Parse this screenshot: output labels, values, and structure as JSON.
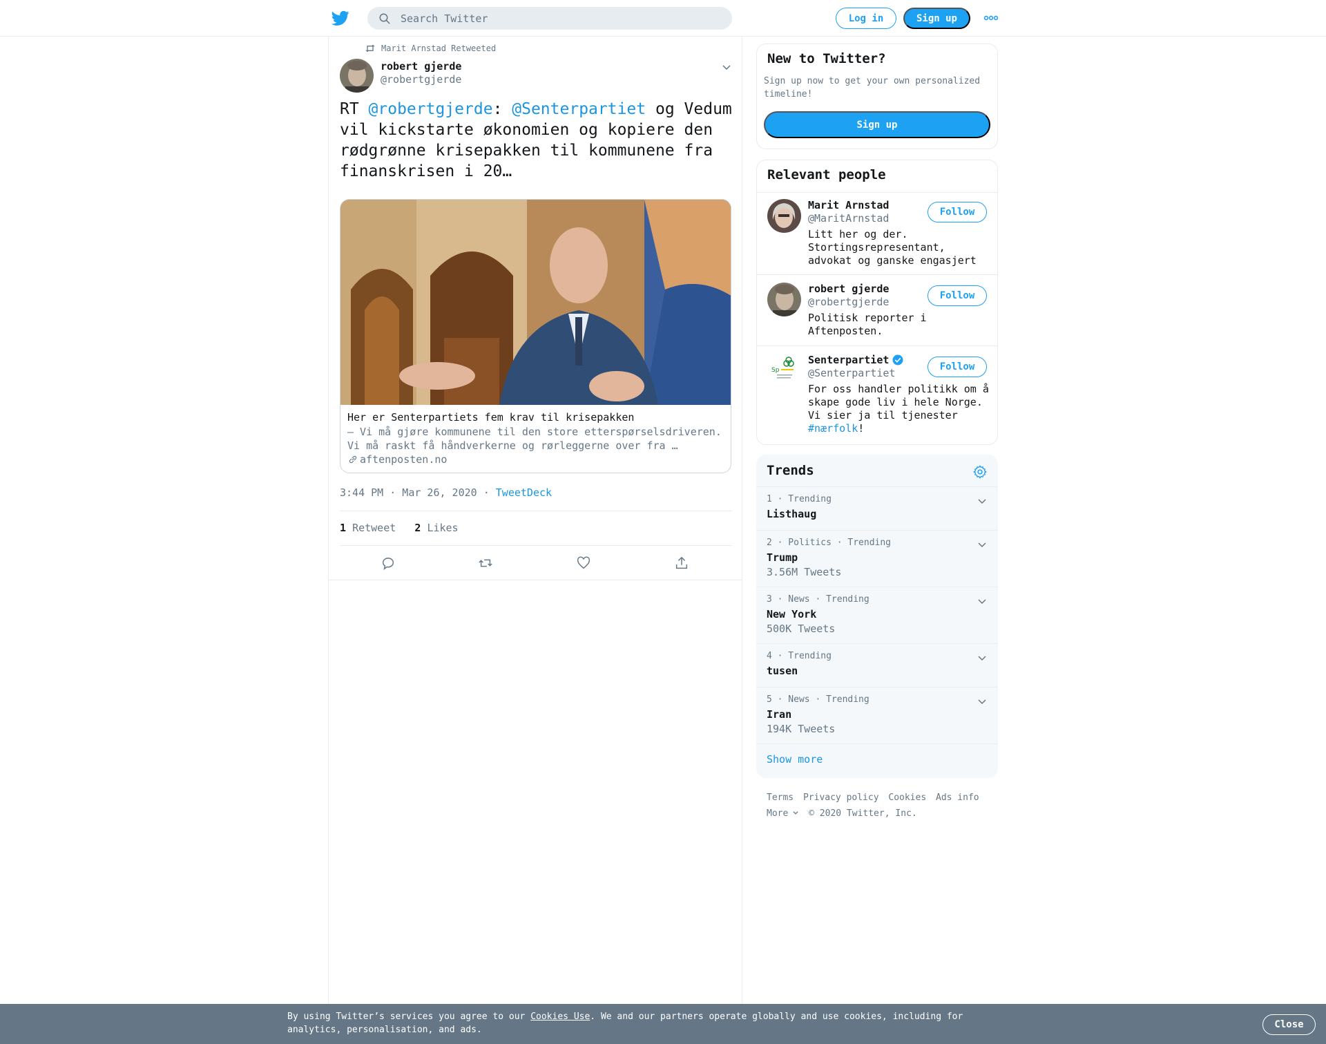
{
  "colors": {
    "accent": "#1da1f2",
    "link": "#1b95e0",
    "muted": "#657786",
    "border": "#e6ecf0",
    "cookie_bg": "#657786"
  },
  "header": {
    "logo_icon": "twitter-bird-icon",
    "search_placeholder": "Search Twitter",
    "login_label": "Log in",
    "signup_label": "Sign up",
    "more_icon": "more-dots-icon"
  },
  "tweet": {
    "retweeted_by": "Marit Arnstad Retweeted",
    "author_name": "robert gjerde",
    "author_handle": "@robertgjerde",
    "text_prefix": "RT ",
    "mention1": "@robertgjerde",
    "colon": ": ",
    "mention2": "@Senterpartiet",
    "text_rest": " og Vedum vil kickstarte økonomien og kopiere den rødgrønne krisepakken til kommunene fra finanskrisen i 20…",
    "card": {
      "title": "Her er Senterpartiets fem krav til krisepakken",
      "description": "– Vi må gjøre kommunene til den store etterspørselsdriveren. Vi må raskt få håndverkerne og rørleggerne over fra …",
      "domain": "aftenposten.no"
    },
    "timestamp": "3:44 PM · Mar 26, 2020",
    "separator": " · ",
    "via": "TweetDeck",
    "retweets_count": "1",
    "retweets_label": "Retweet",
    "likes_count": "2",
    "likes_label": "Likes"
  },
  "sidebar": {
    "new_to_twitter": {
      "title": "New to Twitter?",
      "text": "Sign up now to get your own personalized timeline!",
      "button": "Sign up"
    },
    "relevant_people": {
      "title": "Relevant people",
      "people": [
        {
          "name": "Marit Arnstad",
          "handle": "@MaritArnstad",
          "bio": "Litt her og der. Stortingsrepresentant, advokat og ganske engasjert",
          "follow": "Follow"
        },
        {
          "name": "robert gjerde",
          "handle": "@robertgjerde",
          "bio": "Politisk reporter i Aftenposten.",
          "follow": "Follow"
        },
        {
          "name": "Senterpartiet",
          "handle": "@Senterpartiet",
          "bio_prefix": "For oss handler politikk om å skape gode liv i hele Norge. Vi sier ja til tjenester ",
          "bio_tag": "#nærfolk",
          "bio_suffix": "!",
          "follow": "Follow",
          "verified": true
        }
      ]
    },
    "trends": {
      "title": "Trends",
      "items": [
        {
          "meta": "1 · Trending",
          "name": "Listhaug",
          "count": ""
        },
        {
          "meta": "2 · Politics · Trending",
          "name": "Trump",
          "count": "3.56M Tweets"
        },
        {
          "meta": "3 · News · Trending",
          "name": "New York",
          "count": "500K Tweets"
        },
        {
          "meta": "4 · Trending",
          "name": "tusen",
          "count": ""
        },
        {
          "meta": "5 · News · Trending",
          "name": "Iran",
          "count": "194K Tweets"
        }
      ],
      "show_more": "Show more"
    },
    "footer": {
      "links": [
        "Terms",
        "Privacy policy",
        "Cookies",
        "Ads info"
      ],
      "more": "More",
      "copyright": "© 2020 Twitter, Inc."
    }
  },
  "cookie_bar": {
    "text_before": "By using Twitter’s services you agree to our ",
    "link": "Cookies Use",
    "text_after": ". We and our partners operate globally and use cookies, including for analytics, personalisation, and ads.",
    "close": "Close"
  }
}
